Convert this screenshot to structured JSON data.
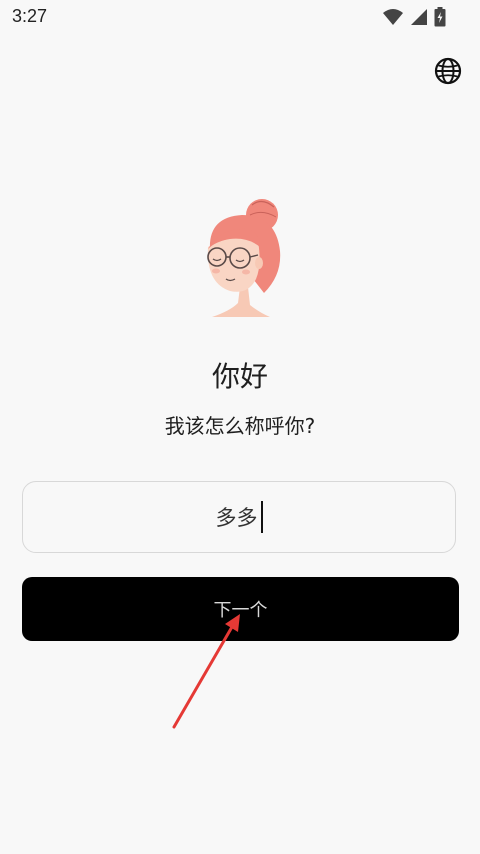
{
  "status_bar": {
    "time": "3:27",
    "icons": [
      "wifi-icon",
      "signal-icon",
      "battery-icon"
    ]
  },
  "header": {
    "language_icon": "globe-icon"
  },
  "main": {
    "greeting": "你好",
    "prompt": "我该怎么称呼你?",
    "name_input": {
      "value": "多多"
    },
    "next_button_label": "下一个"
  },
  "colors": {
    "background": "#f8f8f8",
    "button": "#000000",
    "accent_arrow": "#e53935",
    "avatar_hair": "#f0877b"
  }
}
